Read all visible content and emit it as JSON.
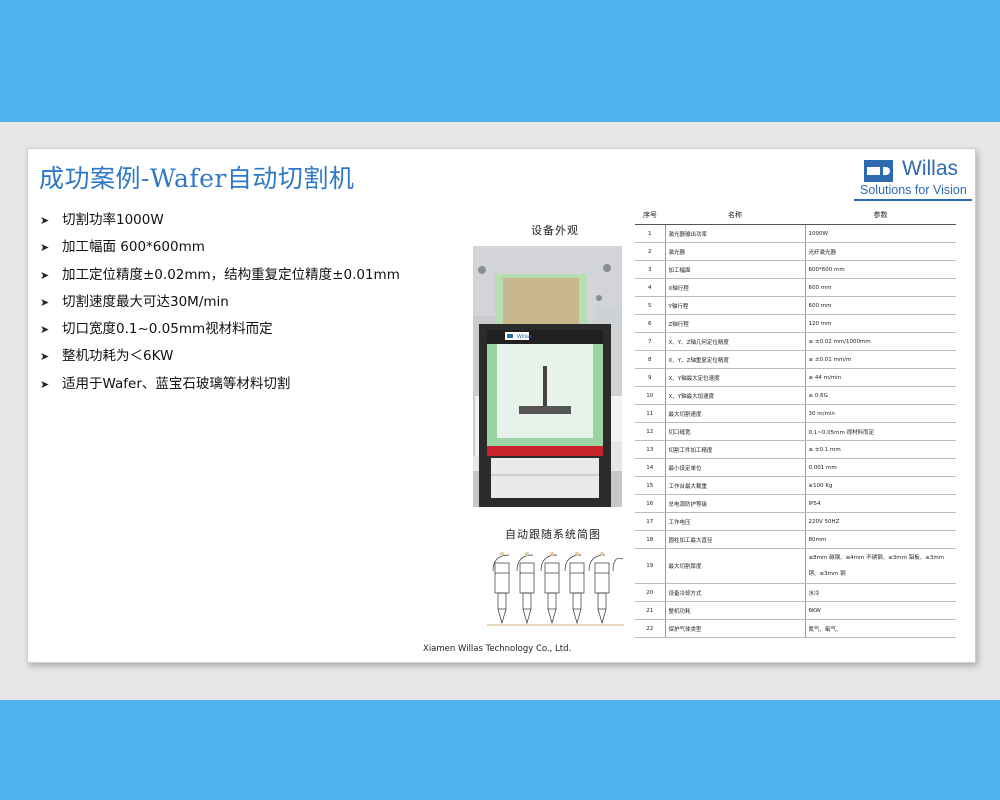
{
  "slide": {
    "title": "成功案例-Wafer自动切割机",
    "logo": {
      "name": "Willas",
      "tagline": "Solutions for Vision",
      "color": "#2e6ab0"
    },
    "bullets": [
      "切割功率1000W",
      "加工幅面 600*600mm",
      "加工定位精度±0.02mm，结构重复定位精度±0.01mm",
      "切割速度最大可达30M/min",
      "切口宽度0.1~0.05mm视材料而定",
      "整机功耗为＜6KW",
      "适用于Wafer、蓝宝石玻璃等材料切割"
    ],
    "photo_caption": "设备外观",
    "photo_brand": "Willas",
    "diagram_caption": "自动跟随系统简图",
    "footer": "Xiamen Willas Technology Co., Ltd."
  },
  "spec_table": {
    "headers": [
      "序号",
      "名称",
      "参数"
    ],
    "rows": [
      [
        "1",
        "激光器输出功率",
        "1000W"
      ],
      [
        "2",
        "激光器",
        "光纤激光器"
      ],
      [
        "3",
        "加工幅面",
        "600*600 mm"
      ],
      [
        "4",
        "X轴行程",
        "600 mm"
      ],
      [
        "5",
        "Y轴行程",
        "600 mm"
      ],
      [
        "6",
        "Z轴行程",
        "120 mm"
      ],
      [
        "7",
        "X、Y、Z轴几何定位精度",
        "≤ ±0.02 mm/1000mm"
      ],
      [
        "8",
        "X、Y、Z轴重复定位精度",
        "≤ ±0.01 mm/m"
      ],
      [
        "9",
        "X、Y轴最大定位速度",
        "≥ 44 m/min"
      ],
      [
        "10",
        "X、Y轴最大加速度",
        "≥ 0.6G"
      ],
      [
        "11",
        "最大切割速度",
        "30 m/min"
      ],
      [
        "12",
        "切口缝宽",
        "0.1~0.05mm 视材料而定"
      ],
      [
        "13",
        "切割工件加工精度",
        "≤ ±0.1 mm"
      ],
      [
        "14",
        "最小设定单位",
        "0.001 mm"
      ],
      [
        "15",
        "工作台最大载重",
        "≥100 Kg"
      ],
      [
        "16",
        "总电源防护等级",
        "IP54"
      ],
      [
        "17",
        "工作电压",
        "220V 50HZ"
      ],
      [
        "18",
        "圆柱加工最大直径",
        "80mm"
      ],
      [
        "19",
        "最大切割厚度",
        "≤8mm 碳钢、≤4mm 不锈钢、≤3mm 铝板、≤3mm 铜、≤3mm 钢"
      ],
      [
        "20",
        "设备冷却方式",
        "水冷"
      ],
      [
        "21",
        "整机功耗",
        "6KW"
      ],
      [
        "22",
        "保护气体类型",
        "氮气、氧气、"
      ]
    ]
  }
}
